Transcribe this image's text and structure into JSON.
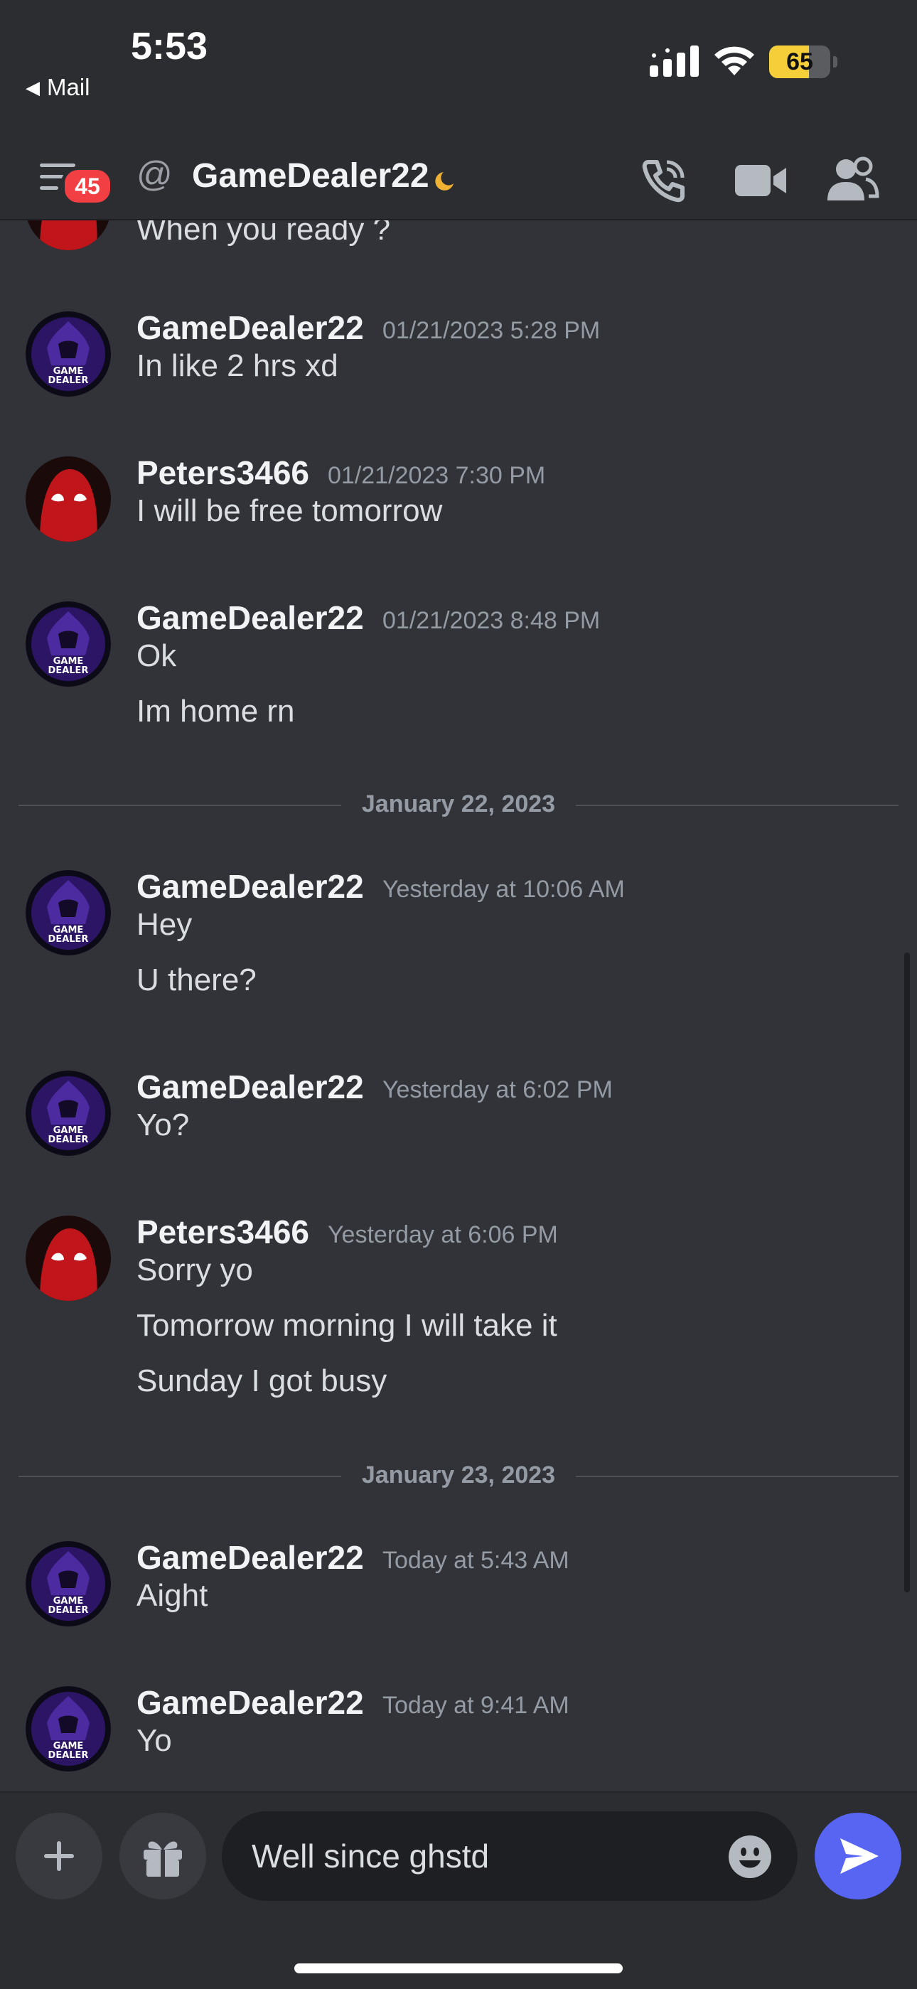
{
  "status_bar": {
    "time": "5:53",
    "back_label": "Mail",
    "battery": "65",
    "battery_level": 0.65
  },
  "header": {
    "badge_count": "45",
    "channel_name": "GameDealer22"
  },
  "colors": {
    "accent": "#5865f2",
    "badge": "#f23f43",
    "background": "#313338",
    "idle_moon": "#f0b232",
    "battery": "#f4cf3a"
  },
  "messages": [
    {
      "partial": true,
      "author": "",
      "timestamp": "",
      "lines": [
        "When you ready ?"
      ]
    },
    {
      "author": "GameDealer22",
      "avatar": "gamedealer-avatar",
      "timestamp": "01/21/2023 5:28 PM",
      "lines": [
        "In like 2 hrs xd"
      ]
    },
    {
      "author": "Peters3466",
      "avatar": "spiderman-avatar",
      "timestamp": "01/21/2023 7:30 PM",
      "lines": [
        "I will be free tomorrow"
      ]
    },
    {
      "author": "GameDealer22",
      "avatar": "gamedealer-avatar",
      "timestamp": "01/21/2023 8:48 PM",
      "lines": [
        "Ok",
        "Im home rn"
      ]
    },
    {
      "author": "GameDealer22",
      "avatar": "gamedealer-avatar",
      "timestamp": "Yesterday at 10:06 AM",
      "lines": [
        "Hey",
        "U there?"
      ]
    },
    {
      "author": "GameDealer22",
      "avatar": "gamedealer-avatar",
      "timestamp": "Yesterday at 6:02 PM",
      "lines": [
        "Yo?"
      ]
    },
    {
      "author": "Peters3466",
      "avatar": "spiderman-avatar",
      "timestamp": "Yesterday at 6:06 PM",
      "lines": [
        "Sorry yo",
        "Tomorrow morning I will take it",
        "Sunday I got busy"
      ]
    },
    {
      "author": "GameDealer22",
      "avatar": "gamedealer-avatar",
      "timestamp": "Today at 5:43 AM",
      "lines": [
        "Aight"
      ]
    },
    {
      "author": "GameDealer22",
      "avatar": "gamedealer-avatar",
      "timestamp": "Today at 9:41 AM",
      "lines": [
        "Yo"
      ]
    }
  ],
  "dividers": [
    "January 22, 2023",
    "January 23, 2023"
  ],
  "avatar_text": {
    "line1": "GAME",
    "line2": "DEALER"
  },
  "composer": {
    "input_value": "Well since ghstd"
  }
}
